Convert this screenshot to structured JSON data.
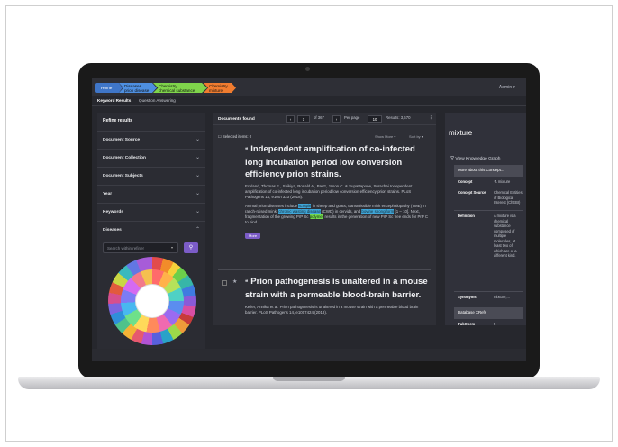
{
  "breadcrumbs": [
    {
      "label": "Home"
    },
    {
      "label": "Diseases\nprion disease"
    },
    {
      "label": "Chemistry\nchemical substance"
    },
    {
      "label": "Chemistry\nmixture"
    }
  ],
  "admin": "Admin ▾",
  "tabs": [
    "Keyword Results",
    "Question Answering"
  ],
  "left_panel": {
    "title": "Refine results",
    "facets": [
      "Document Source",
      "Document Collection",
      "Document Subjects",
      "Year",
      "Keywords",
      "Diseases"
    ],
    "refine_placeholder": "Search within refiner"
  },
  "results": {
    "title": "Documents found",
    "page": "1",
    "page_of": "of 367",
    "per_page_label": "Per page",
    "per_page": "10",
    "results_count": "Results: 3,670",
    "selected": "Selected items: 0",
    "show_more": "Show More ▾",
    "sort": "Sort by ▾"
  },
  "documents": [
    {
      "title": "Independent amplification of co-infected long incubation period low conversion efficiency prion strains.",
      "authors": "Eckland, Thomas E., Shikiya, Ronald A., Bartz, Jason C. & Supattapone, Surachai Independent amplification of co-infected long incubation period low conversion efficiency prion strains. PLoS Pathogens 14, e1007323 (2018).",
      "abstract_pre": "Animal prion diseases include",
      "hl1": "scrapie",
      "abstract_mid": "in sheep and goats, transmissible mink encephalopathy (TME) in ranch-raised mink,",
      "hl2": "chronic wasting disease",
      "abstract_mid2": "(CWD) in cervids, and",
      "hl3": "bovine spongiform",
      "abstract_mid3": "[1 – 10]. Next, fragmentation of the growing PrP Sc",
      "hl4": "polymer",
      "abstract_post": "results in the generation of new PrP Sc free ends for PrP C to bind.",
      "more": "More"
    },
    {
      "title": "Prion pathogenesis is unaltered in a mouse strain with a permeable blood-brain barrier.",
      "authors": "Keller, Annika et al. Prion pathogenesis is unaltered in a mouse strain with a permeable blood brain barrier. PLoS Pathogens 14, e1007424 (2018)."
    }
  ],
  "concept_panel": {
    "concept": "mixture",
    "kg_link": "View Knowledge Graph",
    "about": "More about this Concept...",
    "rows": [
      {
        "k": "Concept",
        "v": "mixture"
      },
      {
        "k": "Concept Source",
        "v": "Chemical Entities of Biological Interest (ChEBI)"
      },
      {
        "k": "Definition",
        "v": "A mixture is a chemical substance composed of multiple molecules, at least two of which are of a different kind."
      },
      {
        "k": "Synonyms",
        "v": "mixture,..."
      }
    ],
    "db_head": "Database XRefs",
    "xrefs": [
      {
        "k": "PubChem",
        "v": "5"
      },
      {
        "k": "UniProtKB",
        "v": "476"
      }
    ]
  },
  "colors": {
    "accent": "#7b5cc7",
    "highlight_blue": "#3fa6d8",
    "highlight_green": "#74d94f",
    "crumb_home": "#3f76c8",
    "crumb_disease": "#4e8fe0",
    "crumb_chem": "#7fd44b",
    "crumb_mixture": "#f07c2f"
  }
}
